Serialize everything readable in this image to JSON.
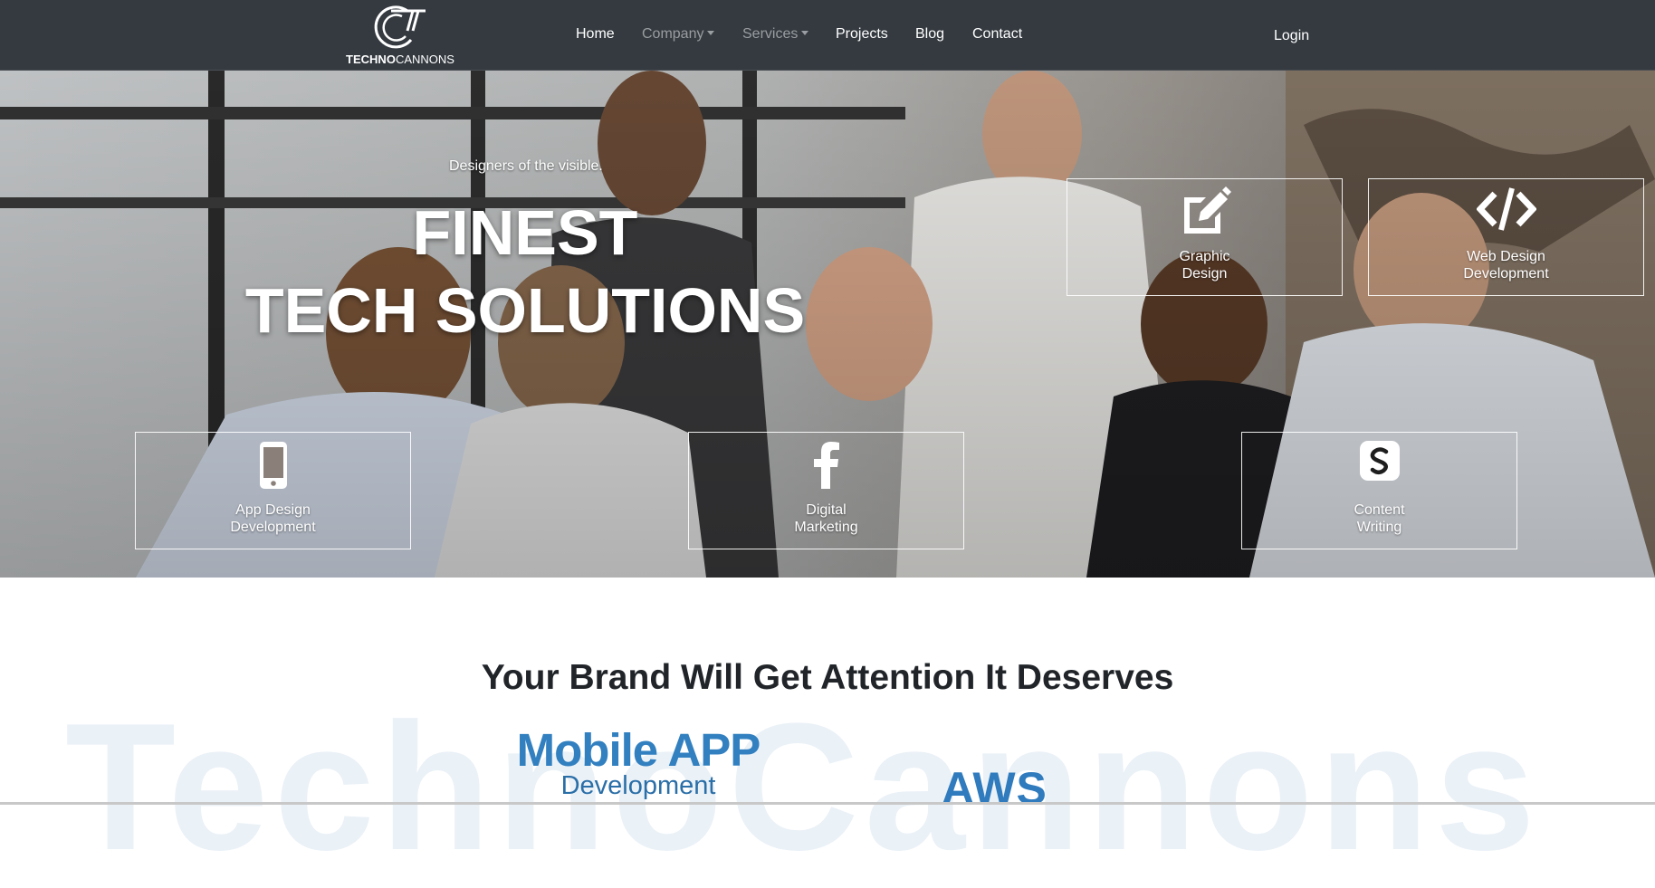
{
  "brand": {
    "logo_bold": "TECHNO",
    "logo_light": "CANNONS"
  },
  "nav": {
    "home": "Home",
    "company": "Company",
    "services": "Services",
    "projects": "Projects",
    "blog": "Blog",
    "contact": "Contact",
    "login": "Login"
  },
  "hero": {
    "tagline": "Designers of the visible.",
    "title_line1": "FINEST",
    "title_line2": "TECH SOLUTIONS",
    "services": [
      {
        "line1": "Graphic",
        "line2": "Design",
        "icon": "edit-icon"
      },
      {
        "line1": "Web Design",
        "line2": "Development",
        "icon": "code-icon"
      },
      {
        "line1": "App Design",
        "line2": "Development",
        "icon": "mobile-phone-icon"
      },
      {
        "line1": "Digital",
        "line2": "Marketing",
        "icon": "facebook-icon"
      },
      {
        "line1": "Content",
        "line2": "Writing",
        "icon": "content-writing-icon"
      }
    ]
  },
  "brand_section": {
    "title": "Your Brand Will Get Attention It Deserves",
    "watermark": "TechnoCannons",
    "promo_mobile_big": "Mobile APP",
    "promo_mobile_small": "Development",
    "promo_aws": "AWS"
  },
  "colors": {
    "navbar_bg": "#343a40",
    "nav_muted": "#9a9da1",
    "promo_blue": "#3280c0",
    "watermark": "#eaf1f7"
  }
}
